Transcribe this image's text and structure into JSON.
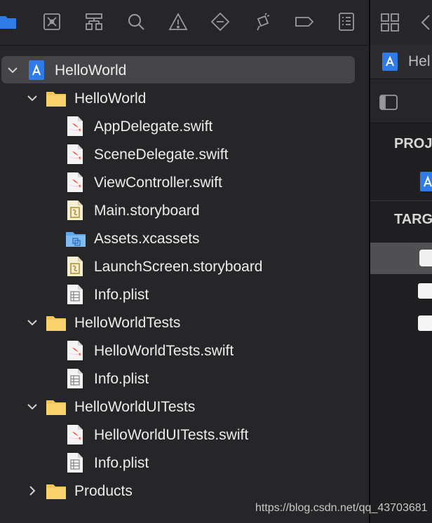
{
  "toolbar": {
    "icons": [
      "folder-icon",
      "source-control-icon",
      "hierarchy-icon",
      "search-icon",
      "warning-icon",
      "test-icon",
      "debug-icon",
      "breakpoint-icon",
      "report-icon"
    ]
  },
  "tree": {
    "project": {
      "label": "HelloWorld"
    },
    "group_app": {
      "label": "HelloWorld",
      "files": [
        {
          "label": "AppDelegate.swift",
          "kind": "swift"
        },
        {
          "label": "SceneDelegate.swift",
          "kind": "swift"
        },
        {
          "label": "ViewController.swift",
          "kind": "swift"
        },
        {
          "label": "Main.storyboard",
          "kind": "storyboard"
        },
        {
          "label": "Assets.xcassets",
          "kind": "assets"
        },
        {
          "label": "LaunchScreen.storyboard",
          "kind": "storyboard"
        },
        {
          "label": "Info.plist",
          "kind": "plist"
        }
      ]
    },
    "group_tests": {
      "label": "HelloWorldTests",
      "files": [
        {
          "label": "HelloWorldTests.swift",
          "kind": "swift"
        },
        {
          "label": "Info.plist",
          "kind": "plist"
        }
      ]
    },
    "group_uitests": {
      "label": "HelloWorldUITests",
      "files": [
        {
          "label": "HelloWorldUITests.swift",
          "kind": "swift"
        },
        {
          "label": "Info.plist",
          "kind": "plist"
        }
      ]
    },
    "group_products": {
      "label": "Products"
    }
  },
  "inspector": {
    "file_name_partial": "Hel",
    "project_section": "PROJ",
    "targets_section": "TARG"
  },
  "watermark": "https://blog.csdn.net/qq_43703681",
  "colors": {
    "accent_blue": "#2f7ce8",
    "folder_yellow": "#f6c65b",
    "swift_orange": "#f05138",
    "background": "#262629",
    "selection": "#454548"
  }
}
